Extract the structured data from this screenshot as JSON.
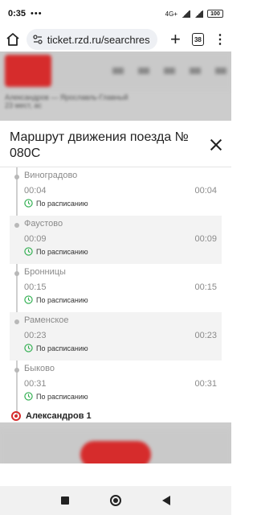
{
  "status": {
    "time": "0:35",
    "dots": "•••",
    "network": "4G+",
    "battery": "100"
  },
  "browser": {
    "url": "ticket.rzd.ru/searchres",
    "tab_count": "38"
  },
  "background": {
    "route_text": "Александров — Ярославль-Главный",
    "route_sub": "23 мест, ас"
  },
  "modal": {
    "title": "Маршрут движения поезда № 080С",
    "schedule_label": "По расписанию",
    "stops": [
      {
        "name": "Виноградово",
        "arrival": "00:04",
        "departure": "00:04",
        "status": "По расписанию"
      },
      {
        "name": "Фаустово",
        "arrival": "00:09",
        "departure": "00:09",
        "status": "По расписанию"
      },
      {
        "name": "Бронницы",
        "arrival": "00:15",
        "departure": "00:15",
        "status": "По расписанию"
      },
      {
        "name": "Раменское",
        "arrival": "00:23",
        "departure": "00:23",
        "status": "По расписанию"
      },
      {
        "name": "Быково",
        "arrival": "00:31",
        "departure": "00:31",
        "status": "По расписанию"
      }
    ],
    "current_stop": "Александров 1"
  },
  "colors": {
    "accent": "#d62c2c",
    "schedule_icon": "#2eae4e"
  }
}
